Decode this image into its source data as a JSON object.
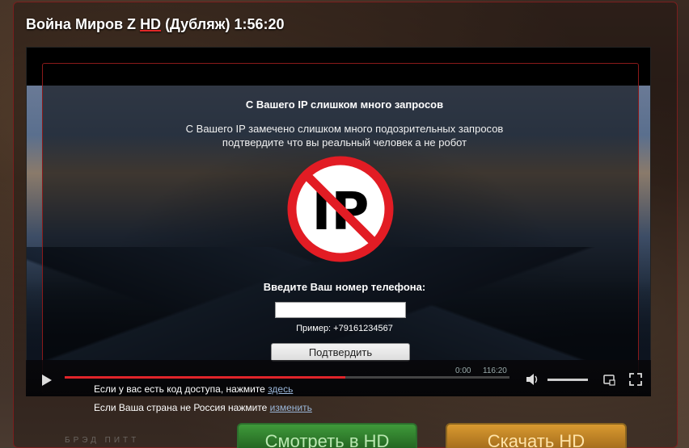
{
  "page": {
    "title_prefix": "Война Миров Z ",
    "title_hd": "HD",
    "title_suffix": " (Дубляж) 1:56:20"
  },
  "overlay": {
    "heading": "С Вашего IP слишком много запросов",
    "line1": "С Вашего IP замечено слишком много подозрительных запросов",
    "line2": "подтвердите что вы реальный человек а не робот",
    "sign_text": "IP",
    "phone_label": "Введите Ваш номер телефона:",
    "phone_value": "",
    "example": "Пример: +79161234567",
    "confirm_label": "Подтвердить"
  },
  "player": {
    "time_current": "0:00",
    "time_total": "116:20",
    "progress": 0.63
  },
  "access": {
    "code_text": "Если у вас есть код доступа, нажмите ",
    "code_link": "здесь",
    "country_text": "Если Ваша страна не Россия нажмите ",
    "country_link": "изменить"
  },
  "buttons": {
    "watch_label": "Смотреть в HD",
    "download_label": "Скачать HD"
  },
  "footer": {
    "brand": "БРЭД ПИТТ"
  },
  "colors": {
    "accent_red": "#e0242a",
    "link": "#9ab6d8",
    "watch_green": "#3f9a3a",
    "download_orange": "#d99a30"
  },
  "icons": {
    "play": "play-icon",
    "volume": "volume-icon",
    "settings": "settings-icon",
    "fullscreen": "fullscreen-icon",
    "no_ip": "no-ip-icon"
  }
}
